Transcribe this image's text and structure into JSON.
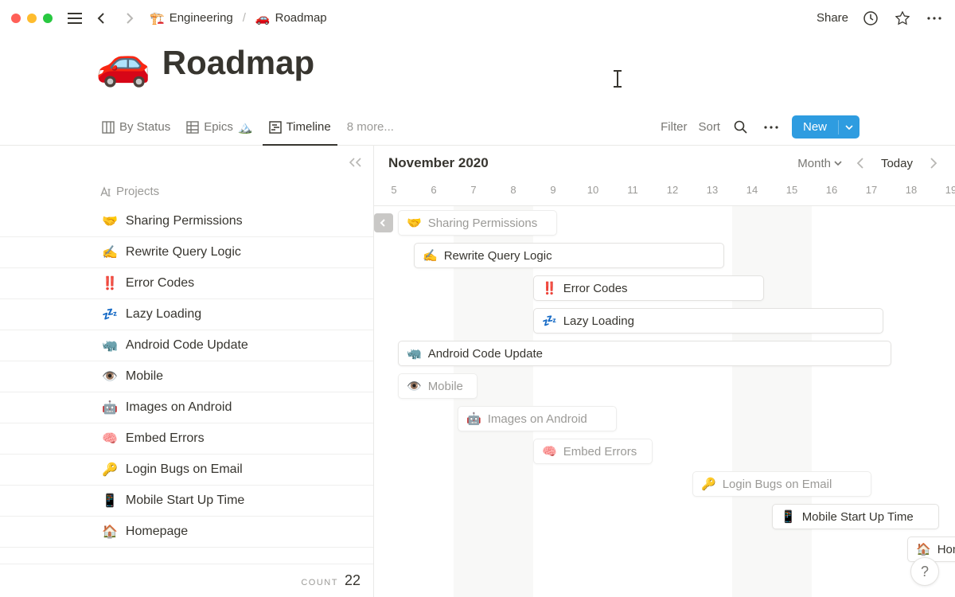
{
  "topbar": {
    "breadcrumb": [
      {
        "emoji": "🏗️",
        "label": "Engineering"
      },
      {
        "emoji": "🚗",
        "label": "Roadmap"
      }
    ],
    "share": "Share"
  },
  "page": {
    "emoji": "🚗",
    "title": "Roadmap"
  },
  "views": {
    "tabs": [
      {
        "label": "By Status",
        "icon": "board"
      },
      {
        "label": "Epics",
        "icon": "table",
        "trailing_emoji": "🏔️"
      },
      {
        "label": "Timeline",
        "icon": "timeline",
        "active": true
      }
    ],
    "more": "8 more...",
    "filter": "Filter",
    "sort": "Sort",
    "new": "New"
  },
  "timeline": {
    "month": "November 2020",
    "range": "Month",
    "today": "Today",
    "days": [
      "5",
      "6",
      "7",
      "8",
      "9",
      "10",
      "11",
      "12",
      "13",
      "14",
      "15",
      "16",
      "17",
      "18",
      "19"
    ],
    "weekend_ranges": [
      [
        2,
        2
      ],
      [
        9,
        2
      ]
    ]
  },
  "sidebar": {
    "header": "Projects",
    "count_label": "COUNT",
    "count": "22"
  },
  "projects": [
    {
      "emoji": "🤝",
      "name": "Sharing Permissions",
      "bar_start": 0.6,
      "bar_span": 4.0,
      "faded": true,
      "back_arrow": true
    },
    {
      "emoji": "✍️",
      "name": "Rewrite Query Logic",
      "bar_start": 1.0,
      "bar_span": 7.8
    },
    {
      "emoji": "‼️",
      "name": "Error Codes",
      "bar_start": 4.0,
      "bar_span": 5.8
    },
    {
      "emoji": "💤",
      "name": "Lazy Loading",
      "bar_start": 4.0,
      "bar_span": 8.8
    },
    {
      "emoji": "🦏",
      "name": "Android Code Update",
      "bar_start": 0.6,
      "bar_span": 12.4
    },
    {
      "emoji": "👁️",
      "name": "Mobile",
      "bar_start": 0.6,
      "bar_span": 2.0,
      "faded": true
    },
    {
      "emoji": "🤖",
      "name": "Images on Android",
      "bar_start": 2.1,
      "bar_span": 4.0,
      "faded": true
    },
    {
      "emoji": "🧠",
      "name": "Embed Errors",
      "bar_start": 4.0,
      "bar_span": 3.0,
      "faded": true
    },
    {
      "emoji": "🔑",
      "name": "Login Bugs on Email",
      "bar_start": 8.0,
      "bar_span": 4.5,
      "faded": true
    },
    {
      "emoji": "📱",
      "name": "Mobile Start Up Time",
      "bar_start": 10.0,
      "bar_span": 4.2
    },
    {
      "emoji": "🏠",
      "name": "Homepage",
      "bar_start": 13.4,
      "bar_span": 1.6
    }
  ]
}
